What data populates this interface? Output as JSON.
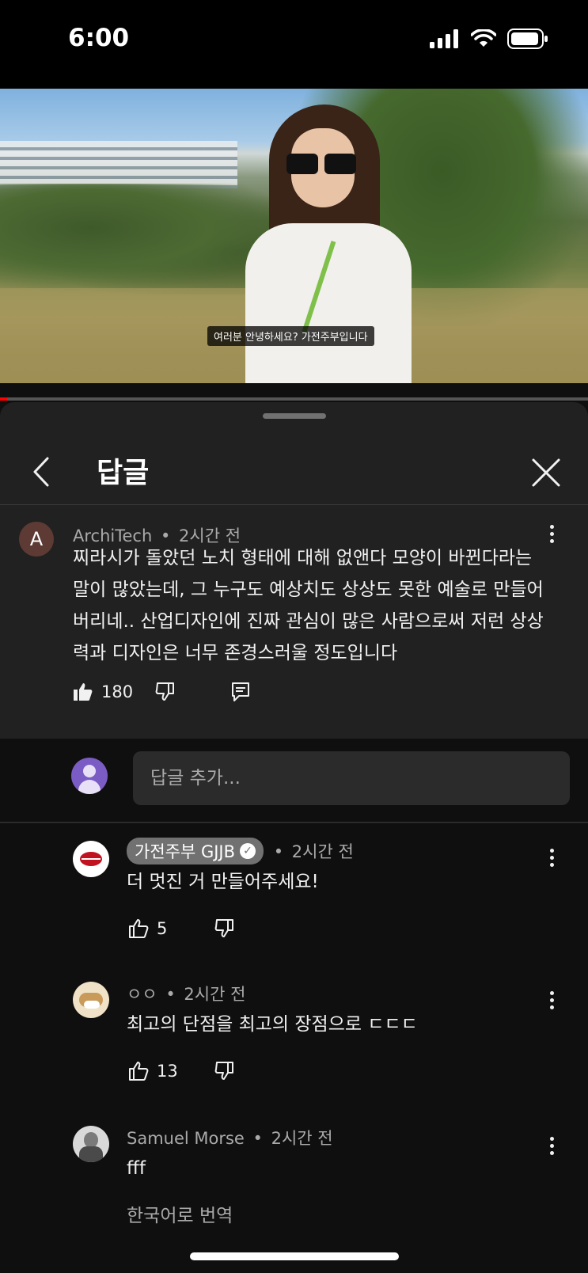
{
  "status_bar": {
    "time": "6:00"
  },
  "video": {
    "caption": "여러분 안녕하세요? 가전주부입니다",
    "progress_fraction": 0.012
  },
  "sheet": {
    "title": "답글"
  },
  "main_comment": {
    "avatar_letter": "A",
    "author": "ArchiTech",
    "time": "2시간 전",
    "text": "찌라시가 돌았던 노치 형태에 대해 없앤다 모양이 바뀐다라는 말이 많았는데, 그 누구도 예상치도 상상도 못한 예술로 만들어버리네.. 산업디자인에 진짜 관심이 많은 사람으로써 저런 상상력과 디자인은 너무 존경스러울 정도입니다",
    "likes": "180"
  },
  "reply_input": {
    "placeholder": "답글 추가..."
  },
  "replies": [
    {
      "author": "가전주부 GJJB",
      "time": "2시간 전",
      "text": "더 멋진 거 만들어주세요!",
      "likes": "5",
      "verified": true
    },
    {
      "author": "ㅇㅇ",
      "time": "2시간 전",
      "text": "최고의 단점을 최고의 장점으로 ㄷㄷㄷ",
      "likes": "13"
    },
    {
      "author": "Samuel Morse",
      "time": "2시간 전",
      "text": "fff",
      "translate": "한국어로 번역"
    }
  ],
  "separator": "•",
  "colors": {
    "background": "#0f0f0f",
    "sheet": "#212121",
    "progress": "#ff0000"
  }
}
